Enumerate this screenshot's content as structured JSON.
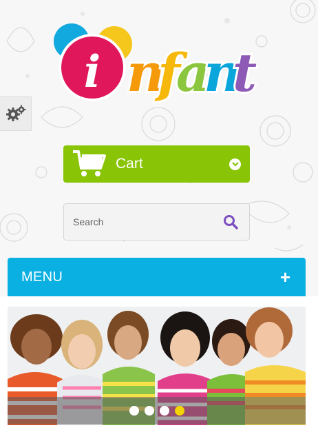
{
  "brand": {
    "logo_text": "infant",
    "logo_letter_colors": [
      "#e0175b",
      "#f59b0b",
      "#f59b0b",
      "#8cc63f",
      "#0aa6db",
      "#8d5ab5"
    ]
  },
  "cart": {
    "label": "Cart",
    "color": "#89c406"
  },
  "search": {
    "placeholder": "Search",
    "icon_color": "#7c4fc0"
  },
  "menu": {
    "label": "MENU",
    "toggle": "+",
    "color": "#0ab0e2"
  },
  "slider": {
    "slides": 4,
    "active_index": 3,
    "active_color": "#f3d300"
  },
  "icons": {
    "settings": "gears-icon",
    "cart": "shopping-cart-icon",
    "search": "search-icon",
    "chevron": "chevron-down-icon"
  }
}
